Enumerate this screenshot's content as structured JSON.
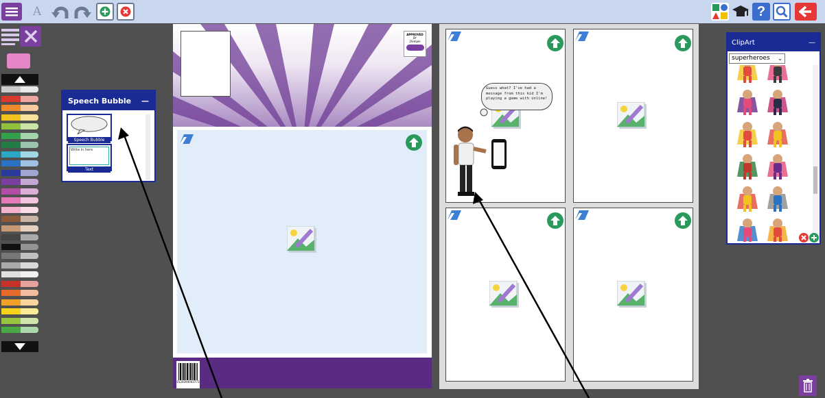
{
  "toolbar": {
    "menu_icon": "hamburger-icon",
    "text_icon_glyph": "A",
    "undo_icon": "undo-icon",
    "redo_icon": "redo-icon",
    "add_page_icon": "add-page-icon",
    "delete_page_icon": "delete-page-icon",
    "right_icons": [
      "share-icon",
      "graduation-cap-icon",
      "help-icon",
      "search-icon",
      "back-arrow-icon"
    ],
    "help_glyph": "?"
  },
  "speech_bubble_panel": {
    "title": "Speech Bubble",
    "minimize_glyph": "—",
    "items": [
      {
        "label": "Speech Bubble"
      },
      {
        "label": "Text",
        "preview_text": "Write in here"
      }
    ]
  },
  "comic": {
    "speech_text": "Guess what? I've had a message from this kid I'm playing a game with online!"
  },
  "cover": {
    "badge_line1": "APPROVED",
    "badge_line2": "BY",
    "badge_line3": "2Simple",
    "barcode_number": "0128394043773"
  },
  "clipart_panel": {
    "title": "ClipArt",
    "minimize_glyph": "—",
    "category_selected": "superheroes"
  },
  "colors": {
    "toolbar_bg": "#c9d7ee",
    "accent_purple": "#7b3fa0",
    "panel_blue": "#1a2b96",
    "arrow_green": "#2a9a5c",
    "back_red": "#e53935"
  }
}
